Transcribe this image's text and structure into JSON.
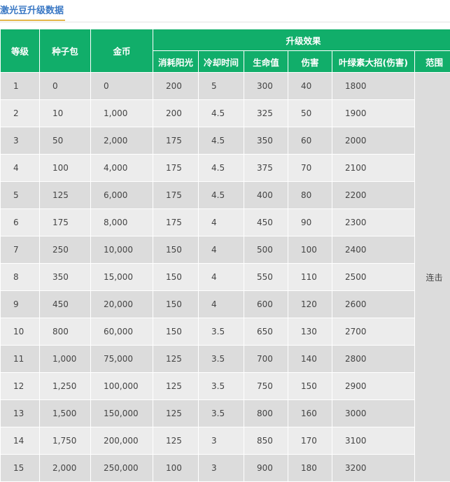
{
  "page": {
    "title": "激光豆升级数据"
  },
  "table": {
    "headers": {
      "level": "等级",
      "seed_pack": "种子包",
      "coins": "金币",
      "upgrade_effect": "升级效果",
      "sun_cost": "消耗阳光",
      "cooldown": "冷却时间",
      "health": "生命值",
      "damage": "伤害",
      "plant_food": "叶绿素大招(伤害)",
      "range": "范围"
    },
    "range_value": "连击",
    "rows": [
      {
        "level": "1",
        "seed_pack": "0",
        "coins": "0",
        "sun_cost": "200",
        "cooldown": "5",
        "health": "300",
        "damage": "40",
        "plant_food": "1800"
      },
      {
        "level": "2",
        "seed_pack": "10",
        "coins": "1,000",
        "sun_cost": "200",
        "cooldown": "4.5",
        "health": "325",
        "damage": "50",
        "plant_food": "1900"
      },
      {
        "level": "3",
        "seed_pack": "50",
        "coins": "2,000",
        "sun_cost": "175",
        "cooldown": "4.5",
        "health": "350",
        "damage": "60",
        "plant_food": "2000"
      },
      {
        "level": "4",
        "seed_pack": "100",
        "coins": "4,000",
        "sun_cost": "175",
        "cooldown": "4.5",
        "health": "375",
        "damage": "70",
        "plant_food": "2100"
      },
      {
        "level": "5",
        "seed_pack": "125",
        "coins": "6,000",
        "sun_cost": "175",
        "cooldown": "4.5",
        "health": "400",
        "damage": "80",
        "plant_food": "2200"
      },
      {
        "level": "6",
        "seed_pack": "175",
        "coins": "8,000",
        "sun_cost": "175",
        "cooldown": "4",
        "health": "450",
        "damage": "90",
        "plant_food": "2300"
      },
      {
        "level": "7",
        "seed_pack": "250",
        "coins": "10,000",
        "sun_cost": "150",
        "cooldown": "4",
        "health": "500",
        "damage": "100",
        "plant_food": "2400"
      },
      {
        "level": "8",
        "seed_pack": "350",
        "coins": "15,000",
        "sun_cost": "150",
        "cooldown": "4",
        "health": "550",
        "damage": "110",
        "plant_food": "2500"
      },
      {
        "level": "9",
        "seed_pack": "450",
        "coins": "20,000",
        "sun_cost": "150",
        "cooldown": "4",
        "health": "600",
        "damage": "120",
        "plant_food": "2600"
      },
      {
        "level": "10",
        "seed_pack": "800",
        "coins": "60,000",
        "sun_cost": "150",
        "cooldown": "3.5",
        "health": "650",
        "damage": "130",
        "plant_food": "2700"
      },
      {
        "level": "11",
        "seed_pack": "1,000",
        "coins": "75,000",
        "sun_cost": "125",
        "cooldown": "3.5",
        "health": "700",
        "damage": "140",
        "plant_food": "2800"
      },
      {
        "level": "12",
        "seed_pack": "1,250",
        "coins": "100,000",
        "sun_cost": "125",
        "cooldown": "3.5",
        "health": "750",
        "damage": "150",
        "plant_food": "2900"
      },
      {
        "level": "13",
        "seed_pack": "1,500",
        "coins": "150,000",
        "sun_cost": "125",
        "cooldown": "3.5",
        "health": "800",
        "damage": "160",
        "plant_food": "3000"
      },
      {
        "level": "14",
        "seed_pack": "1,750",
        "coins": "200,000",
        "sun_cost": "125",
        "cooldown": "3",
        "health": "850",
        "damage": "170",
        "plant_food": "3100"
      },
      {
        "level": "15",
        "seed_pack": "2,000",
        "coins": "250,000",
        "sun_cost": "100",
        "cooldown": "3",
        "health": "900",
        "damage": "180",
        "plant_food": "3200"
      }
    ]
  }
}
